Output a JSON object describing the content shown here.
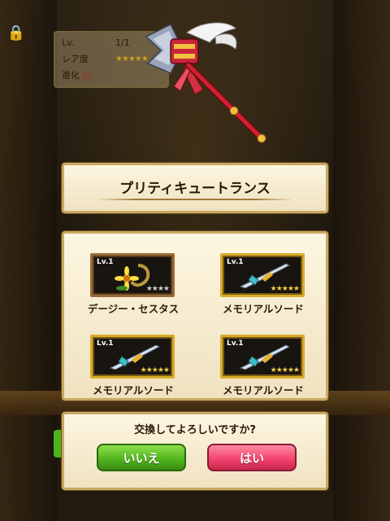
{
  "info": {
    "lv_label": "Lv.",
    "lv_value": "1/1",
    "rarity_label": "レア度",
    "rarity_stars": "★★★★★",
    "evolve_label": "進化",
    "evolve_value": "⃠"
  },
  "dialog": {
    "title": "プリティキュートランス",
    "question": "交換してよろしいですか?",
    "no_label": "いいえ",
    "yes_label": "はい"
  },
  "items": [
    {
      "level": "Lv.1",
      "name": "デージー・セスタス",
      "stars": "★★★★",
      "frame": "bronze"
    },
    {
      "level": "Lv.1",
      "name": "メモリアルソード",
      "stars": "★★★★★",
      "frame": "gold"
    },
    {
      "level": "Lv.1",
      "name": "メモリアルソード",
      "stars": "★★★★★",
      "frame": "gold"
    },
    {
      "level": "Lv.1",
      "name": "メモリアルソード",
      "stars": "★★★★★",
      "frame": "gold"
    }
  ],
  "colors": {
    "panel_border": "#c9a964",
    "no_button": "#4eb21c",
    "yes_button": "#f0406a",
    "gold_frame": "#d8ac2a"
  }
}
